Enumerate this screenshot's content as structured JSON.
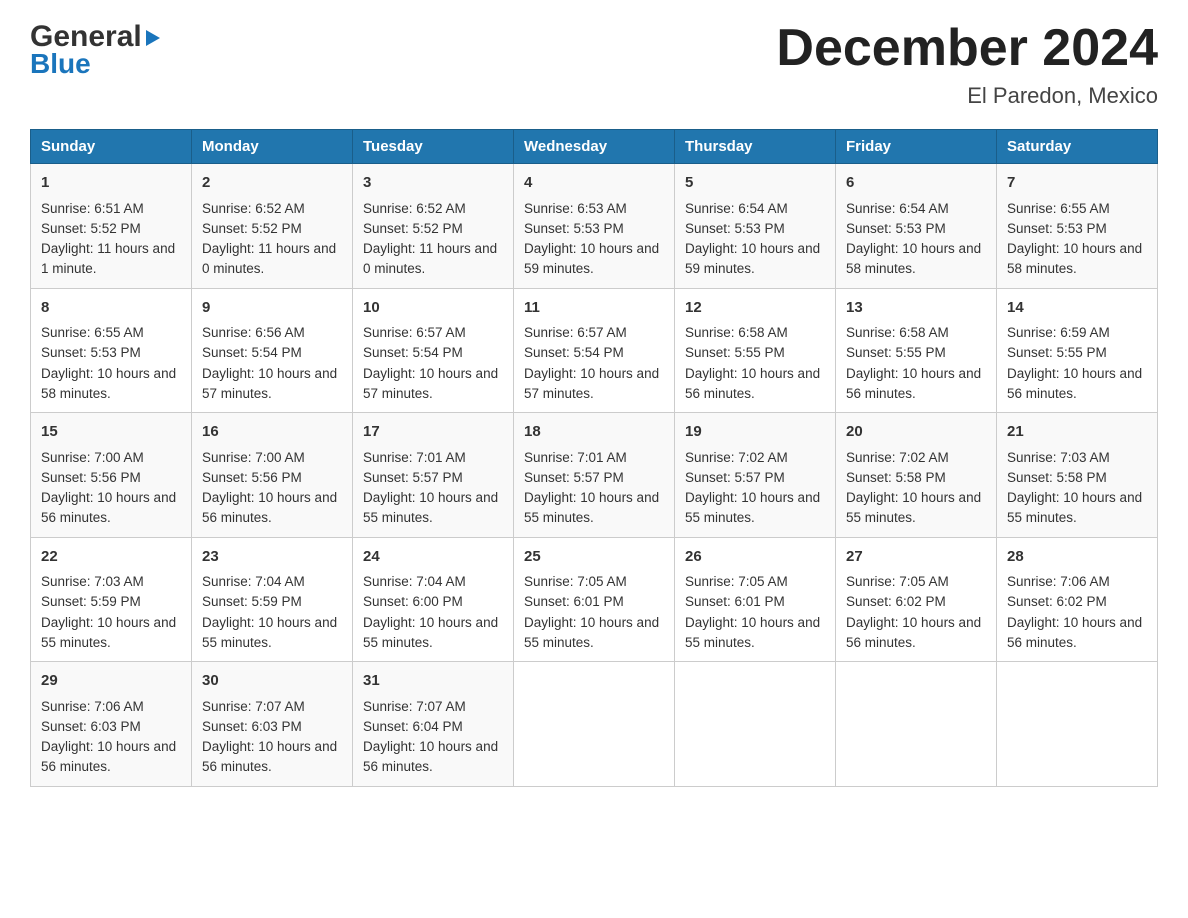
{
  "logo": {
    "general": "General",
    "blue": "Blue",
    "arrow": "▶"
  },
  "title": "December 2024",
  "subtitle": "El Paredon, Mexico",
  "headers": [
    "Sunday",
    "Monday",
    "Tuesday",
    "Wednesday",
    "Thursday",
    "Friday",
    "Saturday"
  ],
  "weeks": [
    [
      {
        "day": "1",
        "sunrise": "Sunrise: 6:51 AM",
        "sunset": "Sunset: 5:52 PM",
        "daylight": "Daylight: 11 hours and 1 minute."
      },
      {
        "day": "2",
        "sunrise": "Sunrise: 6:52 AM",
        "sunset": "Sunset: 5:52 PM",
        "daylight": "Daylight: 11 hours and 0 minutes."
      },
      {
        "day": "3",
        "sunrise": "Sunrise: 6:52 AM",
        "sunset": "Sunset: 5:52 PM",
        "daylight": "Daylight: 11 hours and 0 minutes."
      },
      {
        "day": "4",
        "sunrise": "Sunrise: 6:53 AM",
        "sunset": "Sunset: 5:53 PM",
        "daylight": "Daylight: 10 hours and 59 minutes."
      },
      {
        "day": "5",
        "sunrise": "Sunrise: 6:54 AM",
        "sunset": "Sunset: 5:53 PM",
        "daylight": "Daylight: 10 hours and 59 minutes."
      },
      {
        "day": "6",
        "sunrise": "Sunrise: 6:54 AM",
        "sunset": "Sunset: 5:53 PM",
        "daylight": "Daylight: 10 hours and 58 minutes."
      },
      {
        "day": "7",
        "sunrise": "Sunrise: 6:55 AM",
        "sunset": "Sunset: 5:53 PM",
        "daylight": "Daylight: 10 hours and 58 minutes."
      }
    ],
    [
      {
        "day": "8",
        "sunrise": "Sunrise: 6:55 AM",
        "sunset": "Sunset: 5:53 PM",
        "daylight": "Daylight: 10 hours and 58 minutes."
      },
      {
        "day": "9",
        "sunrise": "Sunrise: 6:56 AM",
        "sunset": "Sunset: 5:54 PM",
        "daylight": "Daylight: 10 hours and 57 minutes."
      },
      {
        "day": "10",
        "sunrise": "Sunrise: 6:57 AM",
        "sunset": "Sunset: 5:54 PM",
        "daylight": "Daylight: 10 hours and 57 minutes."
      },
      {
        "day": "11",
        "sunrise": "Sunrise: 6:57 AM",
        "sunset": "Sunset: 5:54 PM",
        "daylight": "Daylight: 10 hours and 57 minutes."
      },
      {
        "day": "12",
        "sunrise": "Sunrise: 6:58 AM",
        "sunset": "Sunset: 5:55 PM",
        "daylight": "Daylight: 10 hours and 56 minutes."
      },
      {
        "day": "13",
        "sunrise": "Sunrise: 6:58 AM",
        "sunset": "Sunset: 5:55 PM",
        "daylight": "Daylight: 10 hours and 56 minutes."
      },
      {
        "day": "14",
        "sunrise": "Sunrise: 6:59 AM",
        "sunset": "Sunset: 5:55 PM",
        "daylight": "Daylight: 10 hours and 56 minutes."
      }
    ],
    [
      {
        "day": "15",
        "sunrise": "Sunrise: 7:00 AM",
        "sunset": "Sunset: 5:56 PM",
        "daylight": "Daylight: 10 hours and 56 minutes."
      },
      {
        "day": "16",
        "sunrise": "Sunrise: 7:00 AM",
        "sunset": "Sunset: 5:56 PM",
        "daylight": "Daylight: 10 hours and 56 minutes."
      },
      {
        "day": "17",
        "sunrise": "Sunrise: 7:01 AM",
        "sunset": "Sunset: 5:57 PM",
        "daylight": "Daylight: 10 hours and 55 minutes."
      },
      {
        "day": "18",
        "sunrise": "Sunrise: 7:01 AM",
        "sunset": "Sunset: 5:57 PM",
        "daylight": "Daylight: 10 hours and 55 minutes."
      },
      {
        "day": "19",
        "sunrise": "Sunrise: 7:02 AM",
        "sunset": "Sunset: 5:57 PM",
        "daylight": "Daylight: 10 hours and 55 minutes."
      },
      {
        "day": "20",
        "sunrise": "Sunrise: 7:02 AM",
        "sunset": "Sunset: 5:58 PM",
        "daylight": "Daylight: 10 hours and 55 minutes."
      },
      {
        "day": "21",
        "sunrise": "Sunrise: 7:03 AM",
        "sunset": "Sunset: 5:58 PM",
        "daylight": "Daylight: 10 hours and 55 minutes."
      }
    ],
    [
      {
        "day": "22",
        "sunrise": "Sunrise: 7:03 AM",
        "sunset": "Sunset: 5:59 PM",
        "daylight": "Daylight: 10 hours and 55 minutes."
      },
      {
        "day": "23",
        "sunrise": "Sunrise: 7:04 AM",
        "sunset": "Sunset: 5:59 PM",
        "daylight": "Daylight: 10 hours and 55 minutes."
      },
      {
        "day": "24",
        "sunrise": "Sunrise: 7:04 AM",
        "sunset": "Sunset: 6:00 PM",
        "daylight": "Daylight: 10 hours and 55 minutes."
      },
      {
        "day": "25",
        "sunrise": "Sunrise: 7:05 AM",
        "sunset": "Sunset: 6:01 PM",
        "daylight": "Daylight: 10 hours and 55 minutes."
      },
      {
        "day": "26",
        "sunrise": "Sunrise: 7:05 AM",
        "sunset": "Sunset: 6:01 PM",
        "daylight": "Daylight: 10 hours and 55 minutes."
      },
      {
        "day": "27",
        "sunrise": "Sunrise: 7:05 AM",
        "sunset": "Sunset: 6:02 PM",
        "daylight": "Daylight: 10 hours and 56 minutes."
      },
      {
        "day": "28",
        "sunrise": "Sunrise: 7:06 AM",
        "sunset": "Sunset: 6:02 PM",
        "daylight": "Daylight: 10 hours and 56 minutes."
      }
    ],
    [
      {
        "day": "29",
        "sunrise": "Sunrise: 7:06 AM",
        "sunset": "Sunset: 6:03 PM",
        "daylight": "Daylight: 10 hours and 56 minutes."
      },
      {
        "day": "30",
        "sunrise": "Sunrise: 7:07 AM",
        "sunset": "Sunset: 6:03 PM",
        "daylight": "Daylight: 10 hours and 56 minutes."
      },
      {
        "day": "31",
        "sunrise": "Sunrise: 7:07 AM",
        "sunset": "Sunset: 6:04 PM",
        "daylight": "Daylight: 10 hours and 56 minutes."
      },
      null,
      null,
      null,
      null
    ]
  ]
}
